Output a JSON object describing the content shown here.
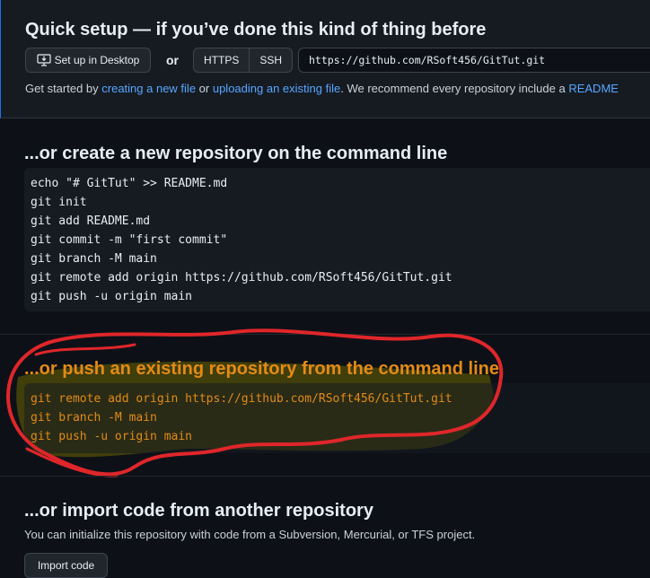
{
  "quick_setup": {
    "title": "Quick setup — if you’ve done this kind of thing before",
    "desktop_button": "Set up in Desktop",
    "or": "or",
    "https_label": "HTTPS",
    "ssh_label": "SSH",
    "clone_url": "https://github.com/RSoft456/GitTut.git",
    "getting_started": {
      "prefix": "Get started by ",
      "link_create": "creating a new file",
      "middle": " or ",
      "link_upload": "uploading an existing file",
      "suffix": ". We recommend every repository include a ",
      "link_readme": "README"
    }
  },
  "create_section": {
    "title": "...or create a new repository on the command line",
    "lines": [
      "echo \"# GitTut\" >> README.md",
      "git init",
      "git add README.md",
      "git commit -m \"first commit\"",
      "git branch -M main",
      "git remote add origin https://github.com/RSoft456/GitTut.git",
      "git push -u origin main"
    ]
  },
  "push_section": {
    "title": "...or push an existing repository from the command line",
    "lines": [
      "git remote add origin https://github.com/RSoft456/GitTut.git",
      "git branch -M main",
      "git push -u origin main"
    ]
  },
  "import_section": {
    "title": "...or import code from another repository",
    "description": "You can initialize this repository with code from a Subversion, Mercurial, or TFS project.",
    "button": "Import code"
  },
  "colors": {
    "background": "#0d1117",
    "panel": "#161b22",
    "link": "#58a6ff",
    "highlight_text": "#e38a17",
    "annotation_red": "#e0262a",
    "annotation_yellow": "#c9c400"
  }
}
